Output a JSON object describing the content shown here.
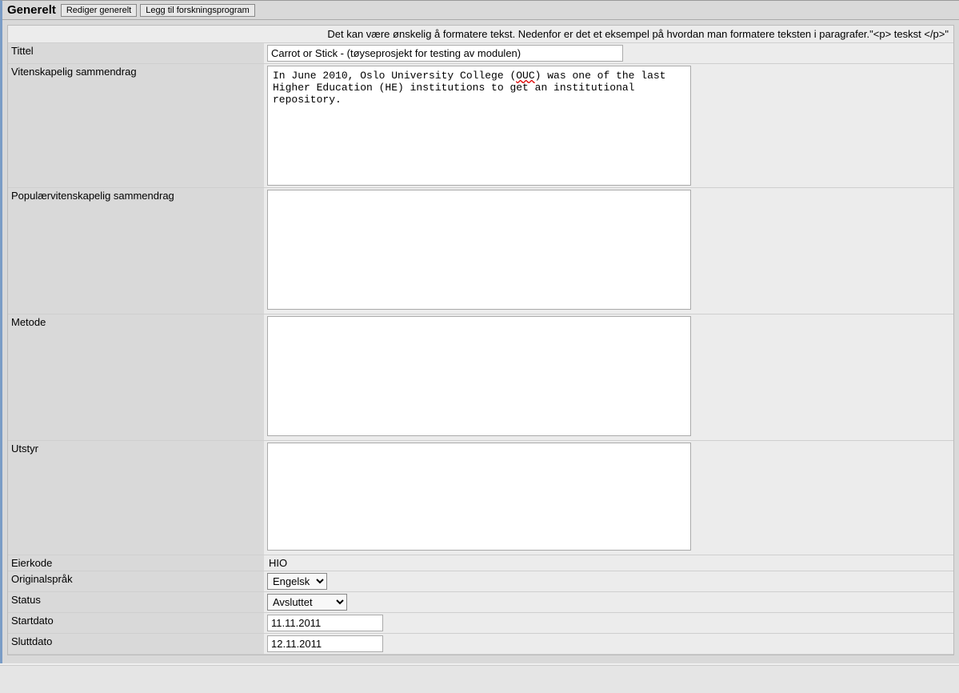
{
  "header": {
    "title": "Generelt",
    "edit_button": "Rediger generelt",
    "add_program_button": "Legg til forskningsprogram"
  },
  "hint": "Det kan være ønskelig å formatere tekst. Nedenfor er det et eksempel på hvordan man formatere teksten i paragrafer.\"<p> teskst </p>\"",
  "fields": {
    "tittel": {
      "label": "Tittel",
      "value": "Carrot or Stick - (tøyseprosjekt for testing av modulen)"
    },
    "vitenskapelig": {
      "label": "Vitenskapelig sammendrag",
      "value_pre": "In June 2010, Oslo University College (",
      "value_spell": "OUC",
      "value_post": ") was one of the last Higher Education (HE) institutions to get an institutional repository."
    },
    "popular": {
      "label": "Populærvitenskapelig sammendrag",
      "value": ""
    },
    "metode": {
      "label": "Metode",
      "value": ""
    },
    "utstyr": {
      "label": "Utstyr",
      "value": ""
    },
    "eierkode": {
      "label": "Eierkode",
      "value": "HIO"
    },
    "sprak": {
      "label": "Originalspråk",
      "selected": "Engelsk"
    },
    "status": {
      "label": "Status",
      "selected": "Avsluttet"
    },
    "startdato": {
      "label": "Startdato",
      "value": "11.11.2011"
    },
    "sluttdato": {
      "label": "Sluttdato",
      "value": "12.11.2011"
    }
  }
}
